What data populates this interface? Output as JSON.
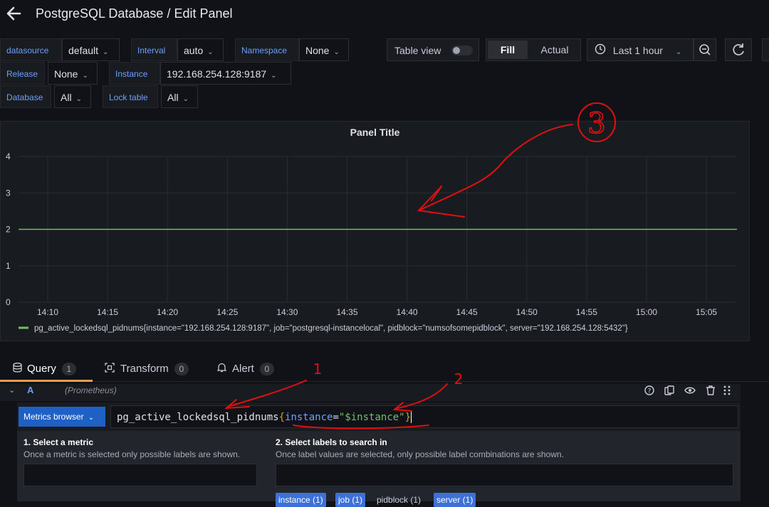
{
  "header": {
    "title": "PostgreSQL Database / Edit Panel"
  },
  "variables": [
    {
      "label": "datasource",
      "value": "default"
    },
    {
      "label": "Interval",
      "value": "auto"
    },
    {
      "label": "Namespace",
      "value": "None"
    },
    {
      "label": "Release",
      "value": "None"
    },
    {
      "label": "Instance",
      "value": "192.168.254.128:9187"
    },
    {
      "label": "Database",
      "value": "All"
    },
    {
      "label": "Lock table",
      "value": "All"
    }
  ],
  "toolbar": {
    "table_view": "Table view",
    "fill": "Fill",
    "actual": "Actual",
    "time_range": "Last 1 hour"
  },
  "panel": {
    "title": "Panel Title"
  },
  "chart_data": {
    "type": "line",
    "title": "Panel Title",
    "x": [
      "14:10",
      "14:15",
      "14:20",
      "14:25",
      "14:30",
      "14:35",
      "14:40",
      "14:45",
      "14:50",
      "14:55",
      "15:00",
      "15:05"
    ],
    "yticks": [
      "0",
      "1",
      "2",
      "3",
      "4"
    ],
    "ylim": [
      0,
      4
    ],
    "grid": true,
    "series": [
      {
        "name": "pg_active_lockedsql_pidnums{instance=\"192.168.254.128:9187\", job=\"postgresql-instancelocal\", pidblock=\"numsofsomepidblock\", server=\"192.168.254.128:5432\"}",
        "values": [
          2,
          2,
          2,
          2,
          2,
          2,
          2,
          2,
          2,
          2,
          2,
          2
        ],
        "color": "#73bf69"
      }
    ],
    "legend": "bottom-left"
  },
  "tabs": [
    {
      "label": "Query",
      "count": "1"
    },
    {
      "label": "Transform",
      "count": "0"
    },
    {
      "label": "Alert",
      "count": "0"
    }
  ],
  "query": {
    "ref": "A",
    "datasource": "(Prometheus)",
    "metrics_browser": "Metrics browser",
    "metric": "pg_active_lockedsql_pidnums",
    "label_key": "instance",
    "label_value": "\"$instance\""
  },
  "browser": {
    "step1_title": "1. Select a metric",
    "step1_help": "Once a metric is selected only possible labels are shown.",
    "step2_title": "2. Select labels to search in",
    "step2_help": "Once label values are selected, only possible label combinations are shown.",
    "chips": [
      "instance (1)",
      "job (1)",
      "pidblock (1)",
      "server (1)"
    ]
  },
  "annotations": [
    "1",
    "2",
    "3"
  ],
  "colors": {
    "accent": "#1f60c4",
    "series": "#73bf69",
    "tab_underline": "#f2994a",
    "annotation": "#e01010"
  }
}
